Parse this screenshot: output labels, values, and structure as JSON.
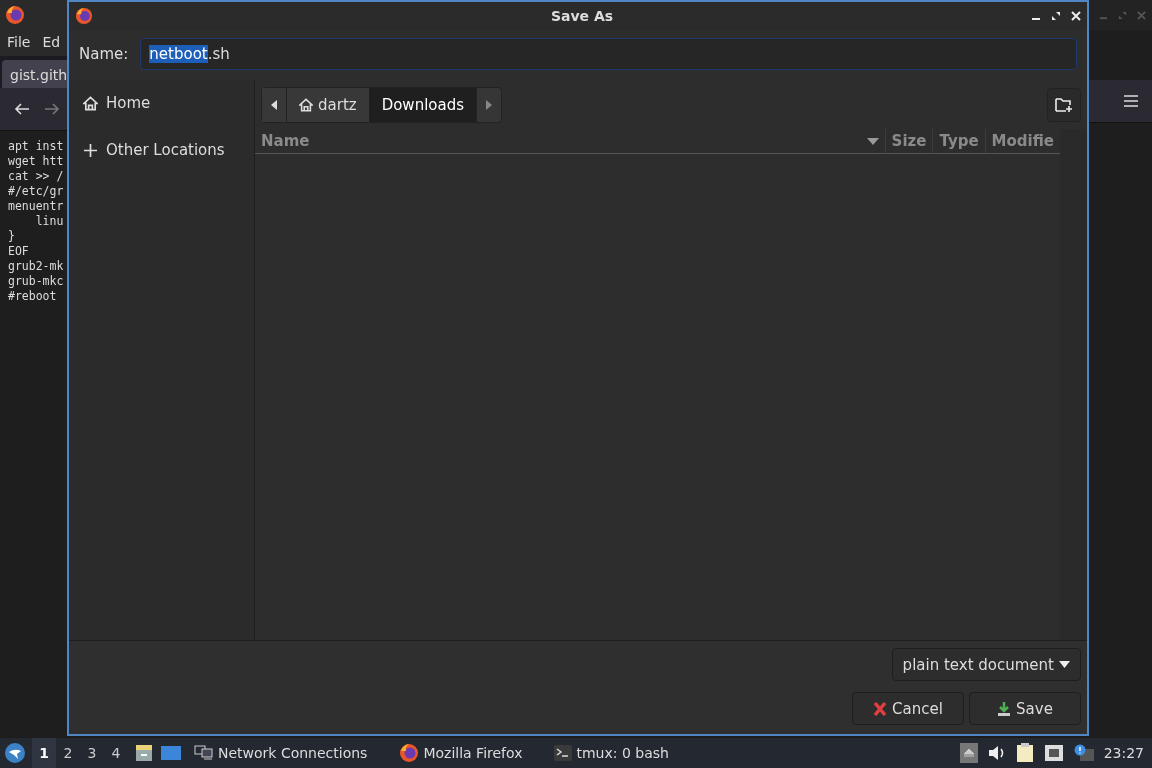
{
  "background_window": {
    "menu": [
      "File",
      "Ed"
    ],
    "tab": "gist.gith",
    "code_lines": [
      "apt inst",
      "wget htt",
      "cat >> /",
      "#/etc/gr",
      "menuentr",
      "    linu",
      "}",
      "EOF",
      "grub2-mk",
      "grub-mkc",
      "#reboot"
    ]
  },
  "dialog": {
    "title": "Save As",
    "name_field": {
      "label": "Name:",
      "selected_text": "netboot",
      "unselected_text": ".sh"
    },
    "sidebar": {
      "items": [
        {
          "kind": "home",
          "label": "Home",
          "selected": false
        },
        {
          "kind": "add",
          "label": "Other Locations",
          "selected": false
        }
      ]
    },
    "path_bar": {
      "items": [
        {
          "kind": "home",
          "label": "dartz",
          "selected": false
        },
        {
          "kind": "folder",
          "label": "Downloads",
          "selected": true
        }
      ]
    },
    "columns": [
      {
        "label": "Name",
        "sorted": true
      },
      {
        "label": "Size",
        "sorted": false
      },
      {
        "label": "Type",
        "sorted": false
      },
      {
        "label": "Modifie",
        "sorted": false
      }
    ],
    "file_type": "plain text document",
    "buttons": [
      {
        "kind": "cancel",
        "label": "Cancel"
      },
      {
        "kind": "save",
        "label": "Save"
      }
    ]
  },
  "taskbar": {
    "workspaces": [
      {
        "label": "1",
        "selected": true
      },
      {
        "label": "2",
        "selected": false
      },
      {
        "label": "3",
        "selected": false
      },
      {
        "label": "4",
        "selected": false
      }
    ],
    "tasks": [
      {
        "kind": "network",
        "label": "Network Connections"
      },
      {
        "kind": "firefox",
        "label": "Mozilla Firefox"
      },
      {
        "kind": "terminal",
        "label": "tmux: 0 bash"
      }
    ],
    "clock": "23:27"
  }
}
